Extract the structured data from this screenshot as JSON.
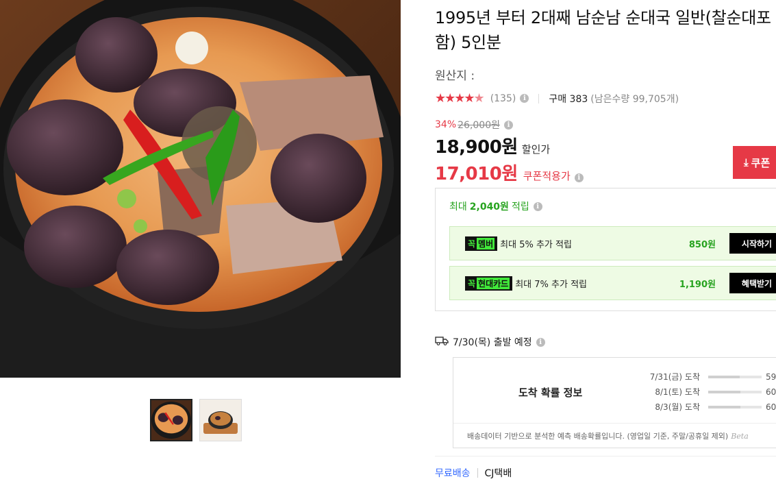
{
  "product": {
    "title": "1995년 부터 2대째 남순남 순대국 일반(찰순대포함) 5인분",
    "origin_label": "원산지 :"
  },
  "rating": {
    "stars_full": "★★★★",
    "stars_half": "★",
    "review_count": "(135)",
    "purchase_label": "구매 383",
    "stock_text": "(남은수량 99,705개)"
  },
  "price": {
    "discount_rate": "34%",
    "original_price": "26,000원",
    "sale_price": "18,900원",
    "sale_label": "할인가",
    "coupon_price": "17,010원",
    "coupon_label": "쿠폰적용가",
    "coupon_button": "쿠폰"
  },
  "reward": {
    "head_prefix": "최대",
    "head_amount": "2,040원",
    "head_suffix": "적립",
    "items": [
      {
        "badge_k": "꼭",
        "badge_t": "멤버",
        "text": "최대 5% 추가 적립",
        "amount": "850원",
        "button": "시작하기"
      },
      {
        "badge_k": "꼭",
        "badge_t": "현대카드",
        "text": "최대 7% 추가 적립",
        "amount": "1,190원",
        "button": "혜택받기"
      }
    ]
  },
  "shipping": {
    "ship_text": "7/30(목) 출발 예정",
    "arrival_title": "도착 확률 정보",
    "arrivals": [
      {
        "date": "7/31(금) 도착",
        "percent": "59",
        "fill": 0.59
      },
      {
        "date": "8/1(토) 도착",
        "percent": "60",
        "fill": 0.6
      },
      {
        "date": "8/3(월) 도착",
        "percent": "60",
        "fill": 0.6
      }
    ],
    "note": "배송데이터 기반으로 분석한 예측 배송확률입니다. (영업일 기준, 주말/공휴일 제외)",
    "note_brand": "Beta"
  },
  "delivery": {
    "type": "무료배송",
    "carrier": "CJ택배"
  },
  "colors": {
    "accent_red": "#e63946",
    "reward_green": "#27a31f",
    "link_blue": "#346aff"
  },
  "icons": [
    "info-icon",
    "truck-icon",
    "download-icon"
  ]
}
